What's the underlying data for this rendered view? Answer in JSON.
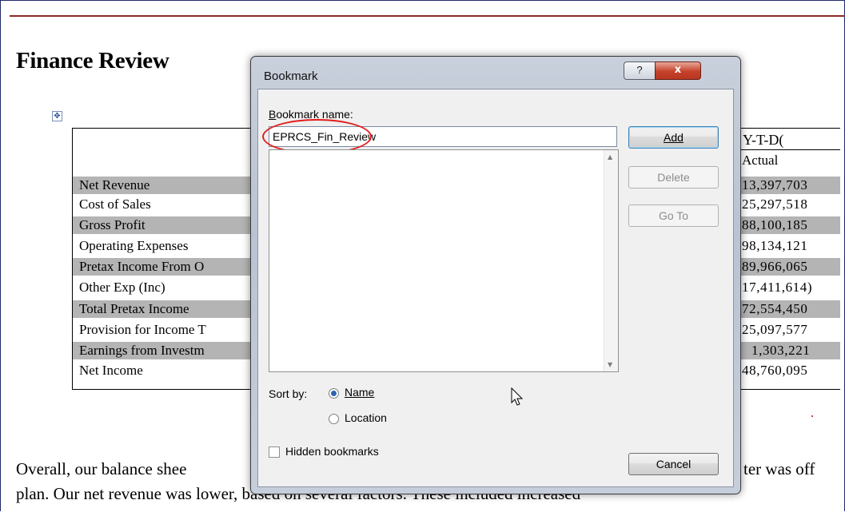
{
  "document": {
    "title": "Finance Review",
    "table": {
      "column_headers": {
        "period": "Y-T-D(",
        "sub": "Actual"
      },
      "rows": [
        {
          "label": "Net Revenue",
          "value": "13,397,703"
        },
        {
          "label": "Cost of Sales",
          "value": "25,297,518"
        },
        {
          "label": "Gross Profit",
          "value": "88,100,185"
        },
        {
          "label": "Operating Expenses",
          "value": "98,134,121"
        },
        {
          "label": "Pretax Income From O",
          "value": "89,966,065"
        },
        {
          "label": "Other Exp (Inc)",
          "value": "17,411,614)"
        },
        {
          "label": "Total Pretax Income",
          "value": "72,554,450"
        },
        {
          "label": "Provision for Income T",
          "value": "25,097,577"
        },
        {
          "label": "Earnings from Investm",
          "value": "1,303,221"
        },
        {
          "label": "Net Income",
          "value": "48,760,095"
        }
      ]
    },
    "paragraph": {
      "line1_left": "Overall, our balance shee",
      "line1_right": "ter was off",
      "line2_left": "plan.  Our net revenue was lower, based on several factors. These included increased"
    }
  },
  "dialog": {
    "title": "Bookmark",
    "help_button": "?",
    "close_button": "x",
    "name_label": "Bookmark name:",
    "name_value": "EPRCS_Fin_Review",
    "buttons": {
      "add": "Add",
      "delete": "Delete",
      "goto": "Go To",
      "cancel": "Cancel"
    },
    "sort_by_label": "Sort by:",
    "sort_options": {
      "name": "Name",
      "location": "Location"
    },
    "sort_selected": "Name",
    "hidden_bookmarks_label": "Hidden bookmarks",
    "hidden_bookmarks_checked": false
  },
  "colors": {
    "highlight_ellipse": "#e31b1b",
    "row_shade": "#b4b4b4",
    "title_rule": "#8c2a2a"
  }
}
